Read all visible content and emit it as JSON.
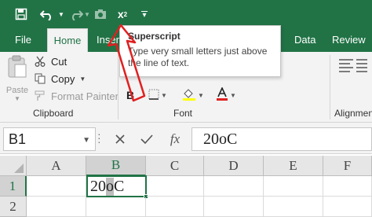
{
  "qat": {
    "superscript_label": "x",
    "superscript_sup": "2",
    "customize_glyph": "▾"
  },
  "tabs": {
    "file": "File",
    "home": "Home",
    "insert": "Inser",
    "data": "Data",
    "review": "Review"
  },
  "ribbon": {
    "paste_label": "Paste",
    "cut_label": "Cut",
    "copy_label": "Copy",
    "format_painter_label": "Format Painter",
    "clipboard_group": "Clipboard",
    "font_group": "Font",
    "alignment_group": "Alignment"
  },
  "tooltip": {
    "title": "Superscript",
    "body": "Type very small letters just above the line of text."
  },
  "formula_bar": {
    "name_box": "B1",
    "fx_label": "fx",
    "formula_value": "20oC"
  },
  "grid": {
    "columns": [
      "A",
      "B",
      "C",
      "D",
      "E",
      "F"
    ],
    "rows": [
      "1",
      "2"
    ],
    "active_cell": {
      "column": "B",
      "row": "1"
    },
    "b1_prefix": "20",
    "b1_highlight": "o",
    "b1_suffix": "C"
  },
  "colors": {
    "accent": "#217346",
    "arrow": "#e02020",
    "font_color_bar": "#e02020"
  },
  "icons": [
    "save-icon",
    "undo-icon",
    "redo-icon",
    "camera-icon",
    "superscript-icon",
    "paste-icon",
    "cut-icon",
    "copy-icon",
    "format-painter-icon",
    "bold-icon",
    "border-icon",
    "fill-color-icon",
    "font-color-icon",
    "cancel-icon",
    "enter-icon",
    "function-icon"
  ]
}
